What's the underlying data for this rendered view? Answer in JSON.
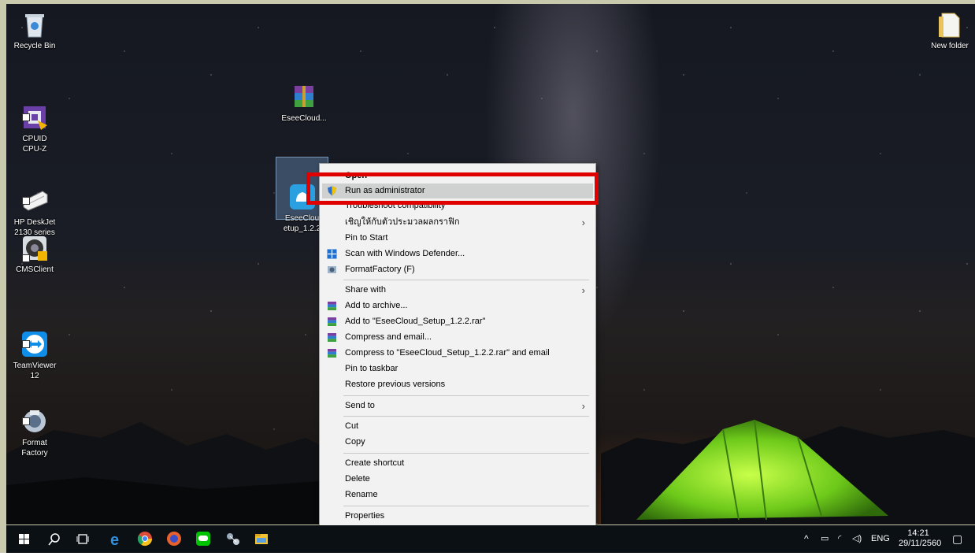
{
  "desktop_icons": [
    {
      "label": "Recycle Bin"
    },
    {
      "label": "CPUID\nCPU-Z"
    },
    {
      "label": "HP DeskJet\n2130 series"
    },
    {
      "label": "CMSClient"
    },
    {
      "label": "TeamViewer\n12"
    },
    {
      "label": "Format\nFactory"
    },
    {
      "label": "EseeCloud..."
    },
    {
      "label": "EseeClou\netup_1.2.2"
    },
    {
      "label": "New folder"
    }
  ],
  "context_menu": {
    "items": [
      {
        "label": "Open"
      },
      {
        "label": "Run as administrator",
        "icon": "uac-shield-icon"
      },
      {
        "label": "Troubleshoot compatibility"
      },
      {
        "label": "เชิญให้กับตัวประมวลผลกราฟิก",
        "submenu": true
      },
      {
        "label": "Pin to Start"
      },
      {
        "label": "Scan with Windows Defender...",
        "icon": "defender-icon"
      },
      {
        "label": "FormatFactory (F)",
        "icon": "formatfactory-icon"
      },
      {
        "label": "Share with",
        "submenu": true
      },
      {
        "label": "Add to archive...",
        "icon": "winrar-icon"
      },
      {
        "label": "Add to \"EseeCloud_Setup_1.2.2.rar\"",
        "icon": "winrar-icon"
      },
      {
        "label": "Compress and email...",
        "icon": "winrar-icon"
      },
      {
        "label": "Compress to \"EseeCloud_Setup_1.2.2.rar\" and email",
        "icon": "winrar-icon"
      },
      {
        "label": "Pin to taskbar"
      },
      {
        "label": "Restore previous versions"
      },
      {
        "label": "Send to",
        "submenu": true
      },
      {
        "label": "Cut"
      },
      {
        "label": "Copy"
      },
      {
        "label": "Create shortcut"
      },
      {
        "label": "Delete"
      },
      {
        "label": "Rename"
      },
      {
        "label": "Properties"
      }
    ]
  },
  "taskbar": {
    "pinned": [
      "start-icon",
      "search-icon",
      "task-view-icon",
      "edge-icon",
      "chrome-icon",
      "firefox-icon",
      "line-icon",
      "network-tool-icon",
      "file-explorer-icon"
    ],
    "tray": {
      "language": "ENG",
      "time": "14:21",
      "date": "29/11/2560"
    }
  },
  "colors": {
    "highlight_border": "#e00000",
    "menu_bg": "#f2f2f2",
    "taskbar_bg": "#0a1014"
  }
}
